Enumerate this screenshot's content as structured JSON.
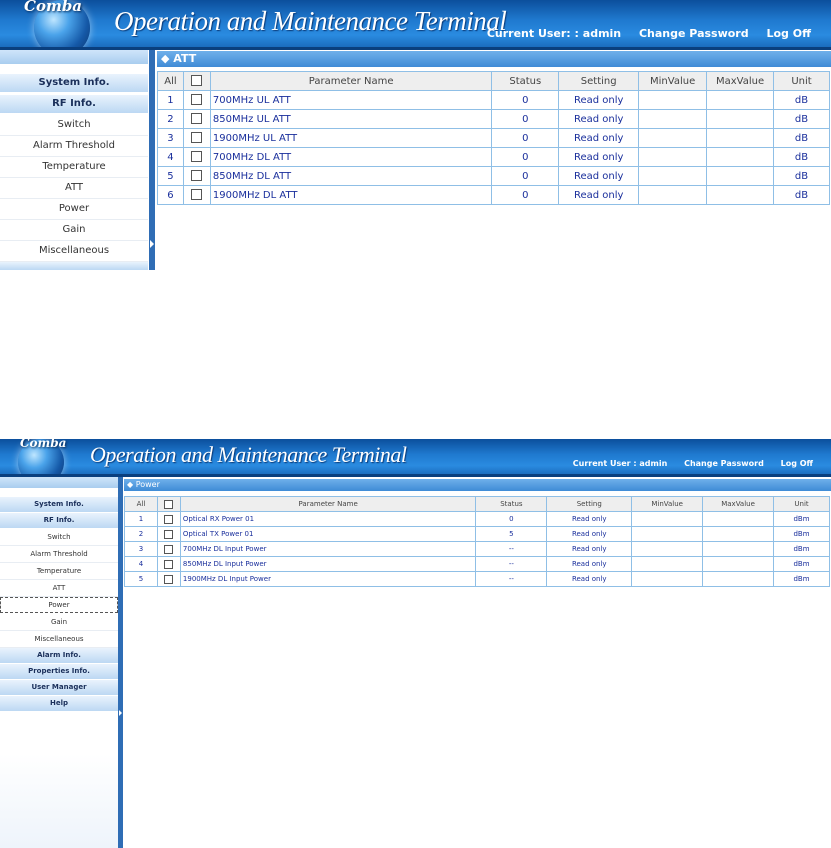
{
  "app": {
    "logo_text": "Comba",
    "title": "Operation and Maintenance Terminal"
  },
  "screen1": {
    "header_nav": {
      "current_user": "Current User: : admin",
      "change_password": "Change Password",
      "log_off": "Log Off"
    },
    "sidebar": {
      "system_info": "System Info.",
      "rf_info": "RF Info.",
      "items": [
        "Switch",
        "Alarm Threshold",
        "Temperature",
        "ATT",
        "Power",
        "Gain",
        "Miscellaneous"
      ]
    },
    "panel_title": "◆ ATT",
    "columns": {
      "all": "All",
      "param": "Parameter Name",
      "status": "Status",
      "setting": "Setting",
      "min": "MinValue",
      "max": "MaxValue",
      "unit": "Unit"
    },
    "rows": [
      {
        "no": "1",
        "name": "700MHz UL ATT",
        "status": "0",
        "setting": "Read only",
        "min": "",
        "max": "",
        "unit": "dB"
      },
      {
        "no": "2",
        "name": "850MHz UL ATT",
        "status": "0",
        "setting": "Read only",
        "min": "",
        "max": "",
        "unit": "dB"
      },
      {
        "no": "3",
        "name": "1900MHz UL ATT",
        "status": "0",
        "setting": "Read only",
        "min": "",
        "max": "",
        "unit": "dB"
      },
      {
        "no": "4",
        "name": "700MHz DL ATT",
        "status": "0",
        "setting": "Read only",
        "min": "",
        "max": "",
        "unit": "dB"
      },
      {
        "no": "5",
        "name": "850MHz DL ATT",
        "status": "0",
        "setting": "Read only",
        "min": "",
        "max": "",
        "unit": "dB"
      },
      {
        "no": "6",
        "name": "1900MHz DL ATT",
        "status": "0",
        "setting": "Read only",
        "min": "",
        "max": "",
        "unit": "dB"
      }
    ]
  },
  "screen2": {
    "header_nav": {
      "current_user": "Current User : admin",
      "change_password": "Change Password",
      "log_off": "Log Off"
    },
    "sidebar": {
      "system_info": "System Info.",
      "rf_info": "RF Info.",
      "items": [
        "Switch",
        "Alarm Threshold",
        "Temperature",
        "ATT",
        "Power",
        "Gain",
        "Miscellaneous"
      ],
      "alarm_info": "Alarm Info.",
      "properties_info": "Properties Info.",
      "user_manager": "User Manager",
      "help": "Help"
    },
    "panel_title": "◆ Power",
    "columns": {
      "all": "All",
      "param": "Parameter Name",
      "status": "Status",
      "setting": "Setting",
      "min": "MinValue",
      "max": "MaxValue",
      "unit": "Unit"
    },
    "rows": [
      {
        "no": "1",
        "name": "Optical RX Power 01",
        "status": "0",
        "setting": "Read only",
        "min": "",
        "max": "",
        "unit": "dBm"
      },
      {
        "no": "2",
        "name": "Optical TX Power 01",
        "status": "5",
        "setting": "Read only",
        "min": "",
        "max": "",
        "unit": "dBm"
      },
      {
        "no": "3",
        "name": "700MHz DL Input Power",
        "status": "--",
        "setting": "Read only",
        "min": "",
        "max": "",
        "unit": "dBm"
      },
      {
        "no": "4",
        "name": "850MHz DL Input Power",
        "status": "--",
        "setting": "Read only",
        "min": "",
        "max": "",
        "unit": "dBm"
      },
      {
        "no": "5",
        "name": "1900MHz DL Input Power",
        "status": "--",
        "setting": "Read only",
        "min": "",
        "max": "",
        "unit": "dBm"
      }
    ]
  }
}
